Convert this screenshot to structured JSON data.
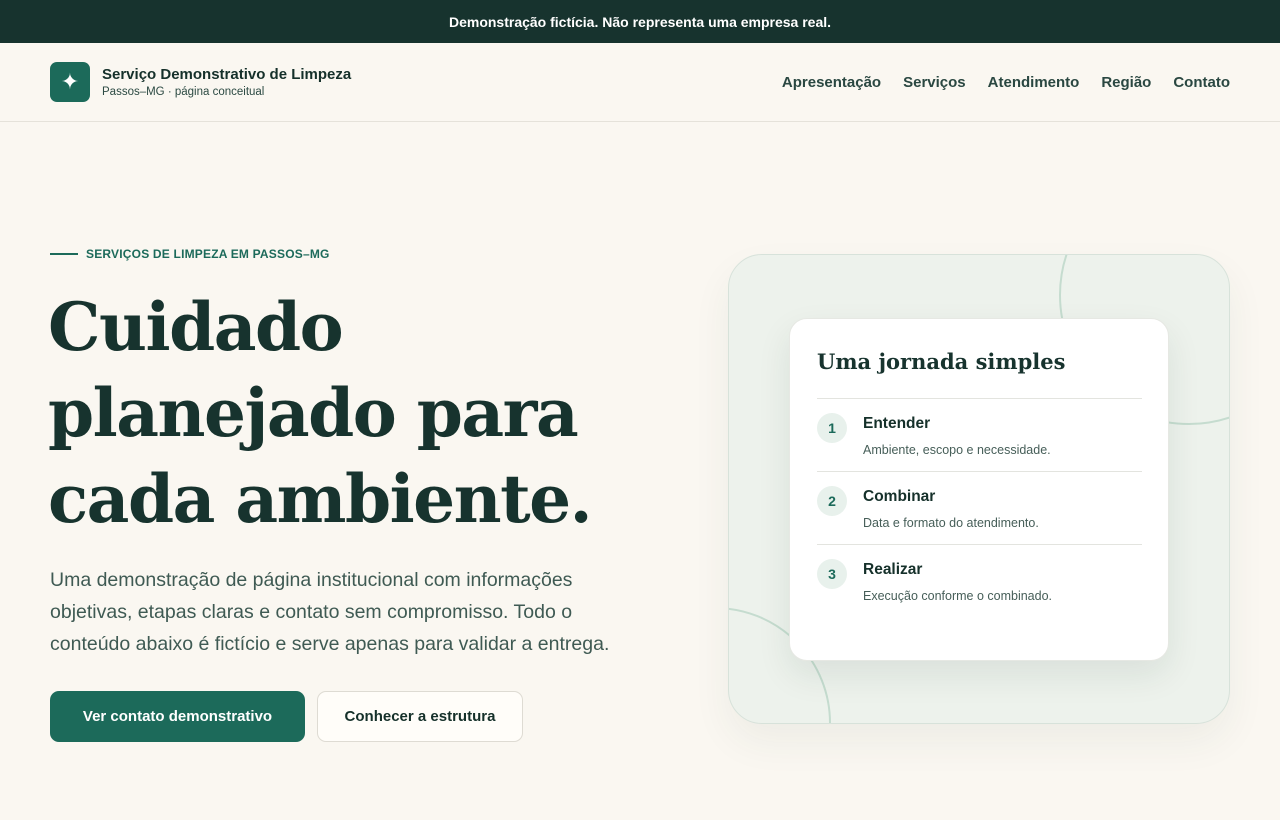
{
  "banner": {
    "text": "Demonstração fictícia. Não representa uma empresa real."
  },
  "brand": {
    "icon": "sparkle-icon",
    "title": "Serviço Demonstrativo de Limpeza",
    "subtitle": "Passos–MG · página conceitual"
  },
  "nav": {
    "items": [
      {
        "label": "Apresentação"
      },
      {
        "label": "Serviços"
      },
      {
        "label": "Atendimento"
      },
      {
        "label": "Região"
      },
      {
        "label": "Contato"
      }
    ]
  },
  "hero": {
    "eyebrow": "SERVIÇOS DE LIMPEZA EM PASSOS–MG",
    "title_lines": [
      "Cuidado",
      "planejado para",
      "cada ambiente."
    ],
    "description": "Uma demonstração de página institucional com informações objetivas, etapas claras e contato sem compromisso. Todo o conteúdo abaixo é fictício e serve apenas para validar a entrega.",
    "primary_button": "Ver contato demonstrativo",
    "secondary_button": "Conhecer a estrutura"
  },
  "journey": {
    "title": "Uma jornada simples",
    "steps": [
      {
        "number": "1",
        "title": "Entender",
        "description": "Ambiente, escopo e necessidade."
      },
      {
        "number": "2",
        "title": "Combinar",
        "description": "Data e formato do atendimento."
      },
      {
        "number": "3",
        "title": "Realizar",
        "description": "Execução conforme o combinado."
      }
    ]
  },
  "colors": {
    "accent": "#1c6a5a",
    "dark": "#17332e",
    "background": "#faf7f1",
    "panel": "#edf2ec"
  }
}
